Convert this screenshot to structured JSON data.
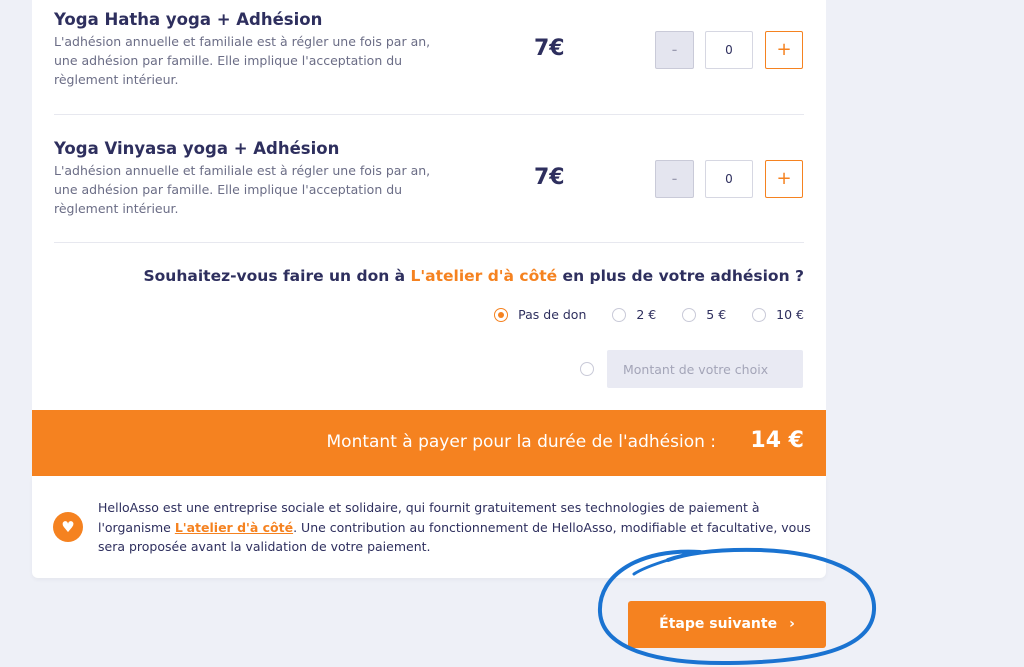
{
  "items": [
    {
      "title": "Yoga Hatha yoga + Adhésion",
      "description": "L'adhésion annuelle et familiale est à régler une fois par an, une adhésion par famille. Elle implique l'acceptation du règlement intérieur.",
      "price": "7€",
      "minus_label": "-",
      "quantity": "0",
      "plus_label": "+"
    },
    {
      "title": "Yoga Vinyasa yoga + Adhésion",
      "description": "L'adhésion annuelle et familiale est à régler une fois par an, une adhésion par famille. Elle implique l'acceptation du règlement intérieur.",
      "price": "7€",
      "minus_label": "-",
      "quantity": "0",
      "plus_label": "+"
    }
  ],
  "donation": {
    "question_before": "Souhaitez-vous faire un don à ",
    "org_name": "L'atelier d'à côté",
    "question_after": " en plus de votre adhésion ?",
    "options": [
      {
        "label": "Pas de don",
        "checked": true
      },
      {
        "label": "2 €",
        "checked": false
      },
      {
        "label": "5 €",
        "checked": false
      },
      {
        "label": "10 €",
        "checked": false
      }
    ],
    "custom_placeholder": "Montant de votre choix"
  },
  "total": {
    "label": "Montant à payer pour la durée de l'adhésion :",
    "amount": "14 €"
  },
  "info": {
    "text_before": "HelloAsso est une entreprise sociale et solidaire, qui fournit gratuitement ses technologies de paiement à l'organisme ",
    "link_text": "L'atelier d'à côté",
    "text_after": ". Une contribution au fonctionnement de HelloAsso, modifiable et facultative, vous sera proposée avant la validation de votre paiement."
  },
  "next_button": {
    "label": "Étape suivante",
    "chevron": "›"
  },
  "colors": {
    "accent": "#f58220",
    "text_dark": "#2e2f5e",
    "annotation": "#1a73d1"
  },
  "icons": {
    "heart": "heart-icon",
    "next": "chevron-right-icon"
  }
}
